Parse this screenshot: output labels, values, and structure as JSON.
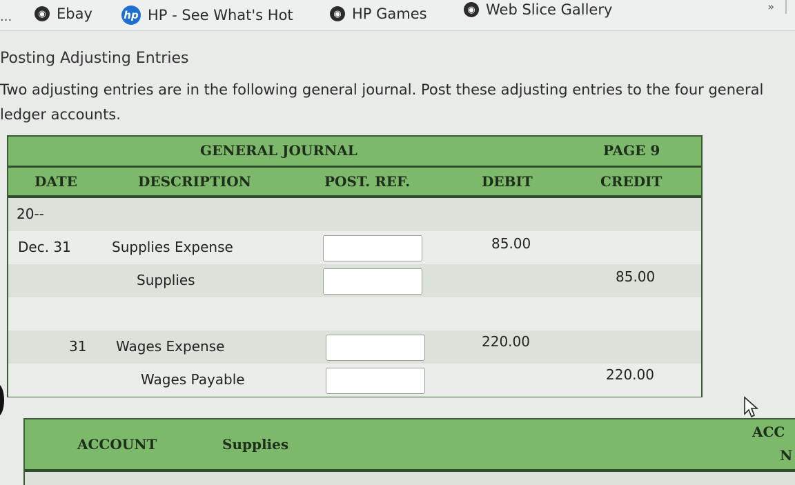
{
  "favorites": {
    "more": "...",
    "items": [
      {
        "label": "Ebay",
        "icon": "globe-icon"
      },
      {
        "label": "HP - See What's Hot",
        "icon": "hp-logo-icon"
      },
      {
        "label": "HP Games",
        "icon": "globe-icon"
      },
      {
        "label": "Web Slice Gallery",
        "icon": "globe-icon"
      }
    ],
    "chevron": "»"
  },
  "page": {
    "title": "Posting Adjusting Entries",
    "instructions": "Two adjusting entries are in the following general journal. Post these adjusting entries to the four general ledger accounts."
  },
  "journal": {
    "title": "GENERAL JOURNAL",
    "page": "PAGE 9",
    "columns": {
      "date": "DATE",
      "description": "DESCRIPTION",
      "post_ref": "POST. REF.",
      "debit": "DEBIT",
      "credit": "CREDIT"
    },
    "rows": [
      {
        "date": "20--",
        "description": "",
        "debit": "",
        "credit": ""
      },
      {
        "date": "Dec. 31",
        "description": "Supplies Expense",
        "debit": "85.00",
        "credit": ""
      },
      {
        "date": "",
        "description": "Supplies",
        "debit": "",
        "credit": "85.00"
      },
      {
        "date": "",
        "description": "",
        "debit": "",
        "credit": ""
      },
      {
        "date": "31",
        "description": "Wages Expense",
        "debit": "220.00",
        "credit": ""
      },
      {
        "date": "",
        "description": "Wages Payable",
        "debit": "",
        "credit": "220.00"
      }
    ]
  },
  "ledger": {
    "account_label": "ACCOUNT",
    "account_name": "Supplies",
    "right_label_1": "ACC",
    "right_label_2": "N"
  },
  "colors": {
    "header_green": "#7cb96a",
    "dark_green": "#2f4d2a"
  }
}
